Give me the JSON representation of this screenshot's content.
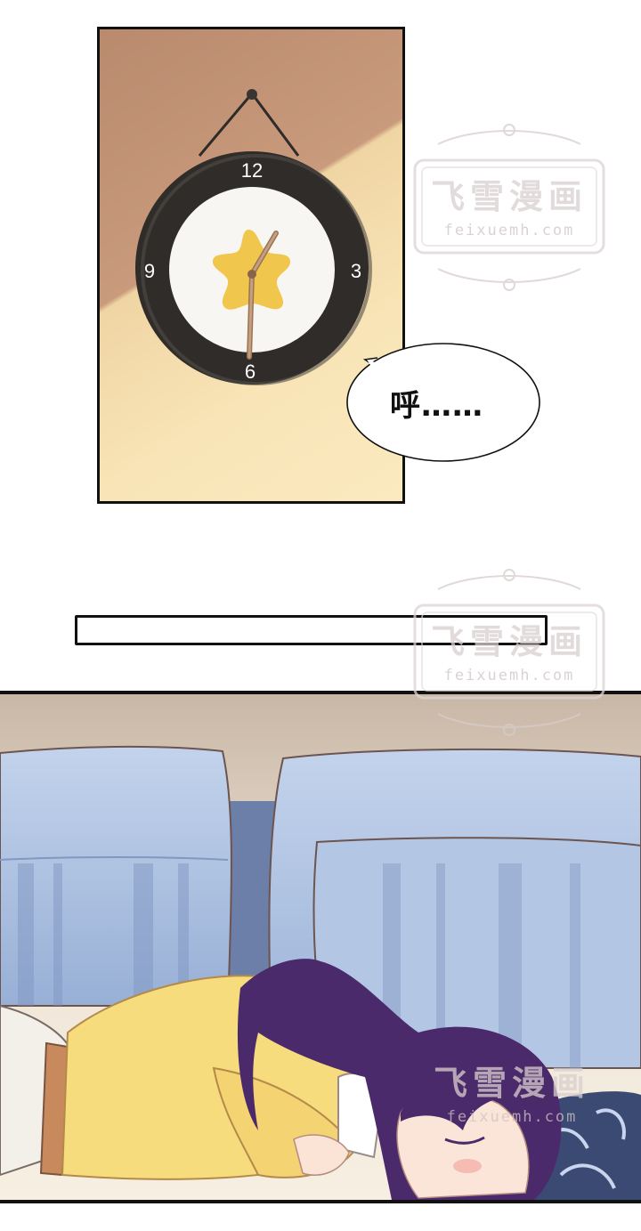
{
  "clock": {
    "numbers": {
      "twelve": "12",
      "three": "3",
      "six": "6",
      "nine": "9"
    }
  },
  "speech_bubble": {
    "text": "呼……"
  },
  "watermark": {
    "title": "飞雪漫画",
    "url": "feixuemh.com"
  },
  "colors": {
    "panel_border": "#111111",
    "wall_shadow": "#c39577",
    "wall_light": "#f8e4b6",
    "clock_rim": "#2e2b29",
    "clock_star": "#f1c64d",
    "sofa": "#a9bedc",
    "sweater": "#f6dc7d",
    "hair": "#4a2a6a"
  }
}
